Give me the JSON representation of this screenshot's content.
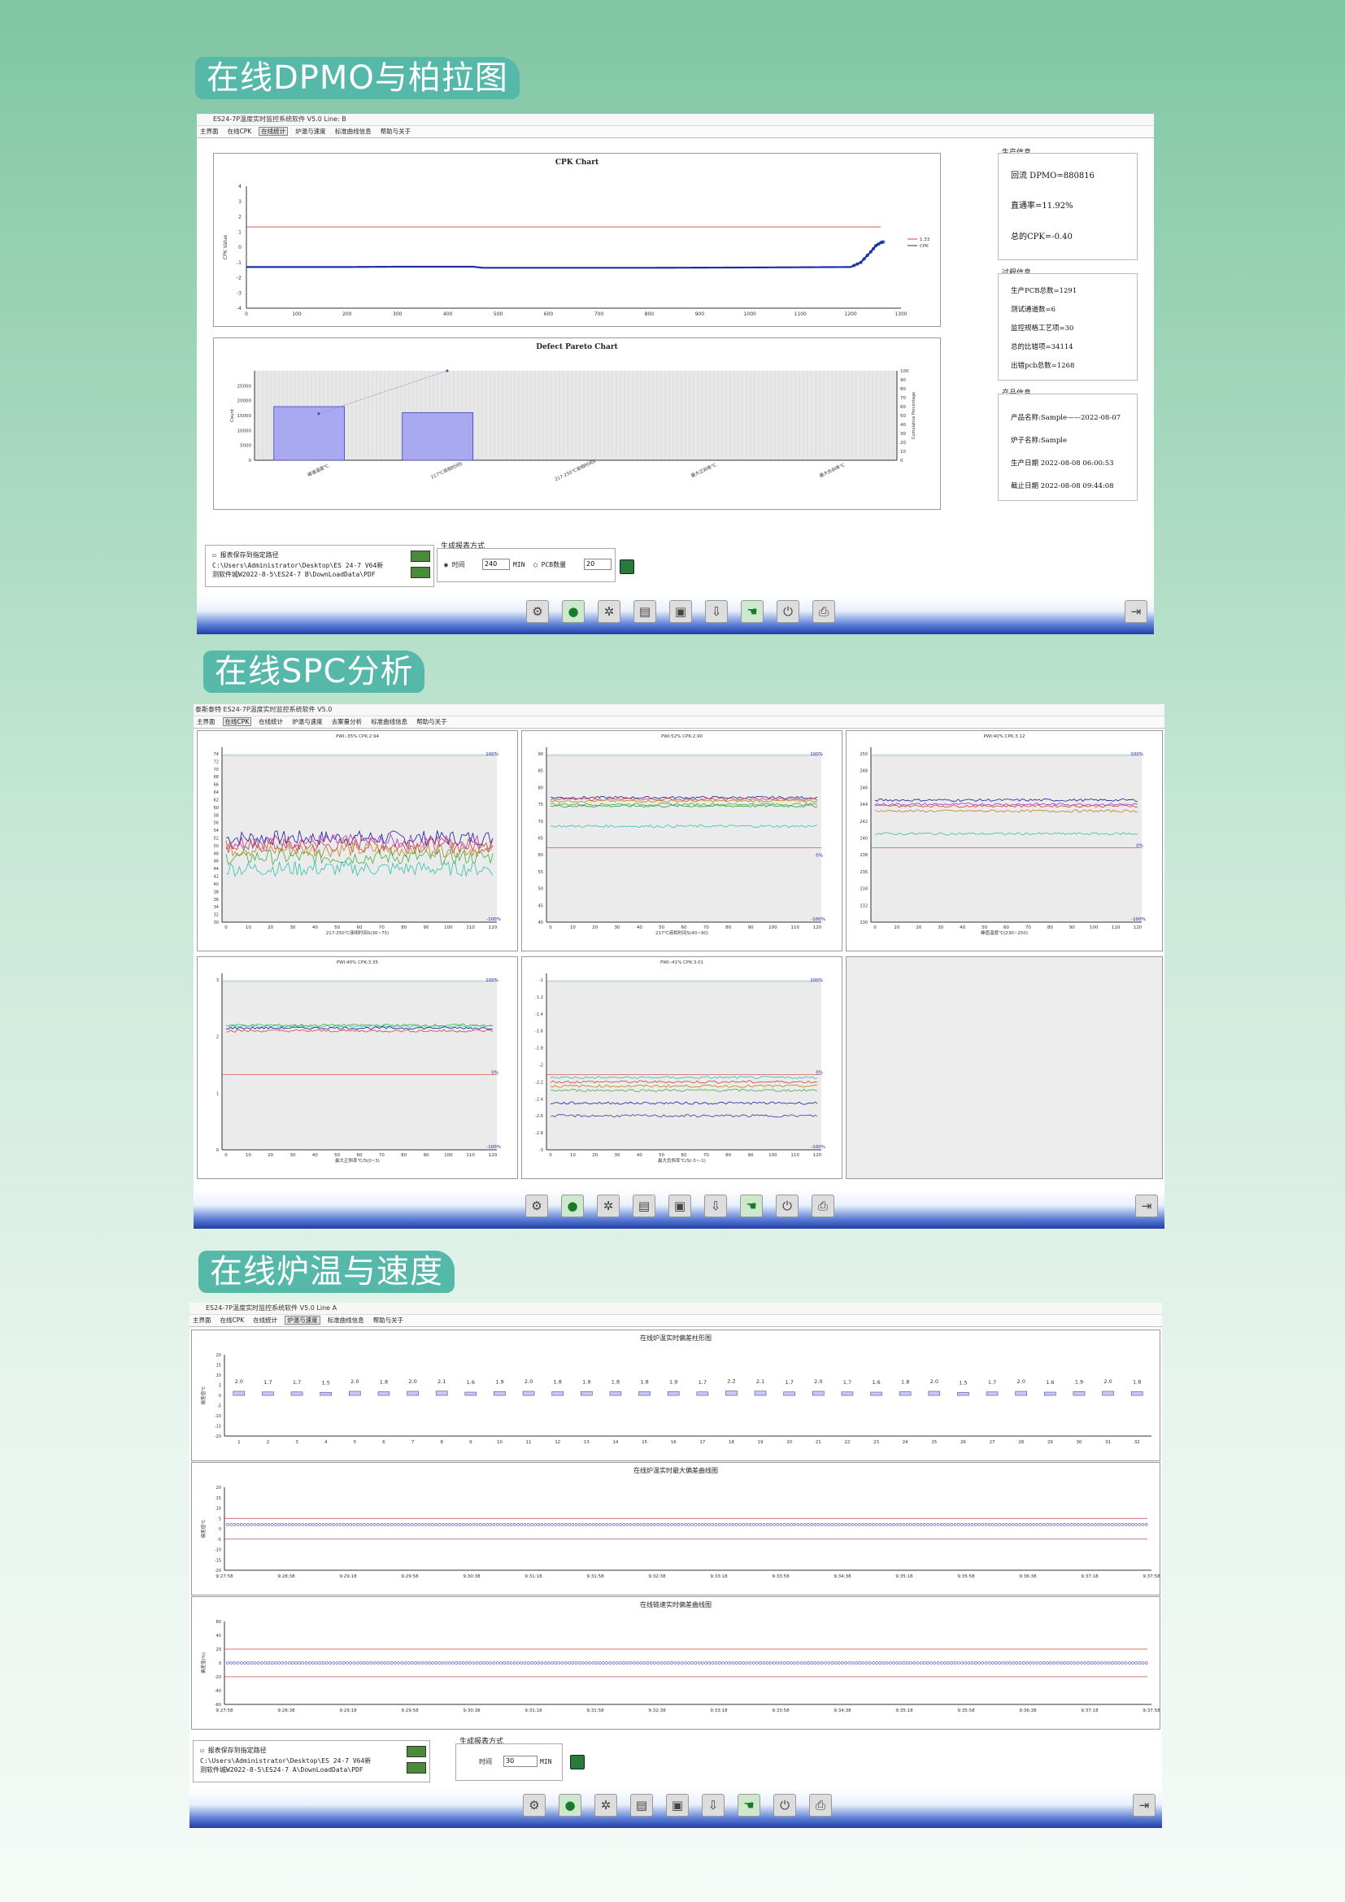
{
  "sections": {
    "s1": "在线DPMO与柏拉图",
    "s2": "在线SPC分析",
    "s3": "在线炉温与速度"
  },
  "panel1": {
    "titlebar": "ES24-7P温度实时监控系统软件 V5.0        Line: B",
    "menu": [
      "主界面",
      "在线CPK",
      "在线统计",
      "炉温与速度",
      "标准曲线信息",
      "帮助与关于"
    ],
    "active_menu": "在线统计",
    "cpk_chart_title": "CPK Chart",
    "pareto_title": "Defect Pareto Chart",
    "prod_info": {
      "group_label": "生产信息",
      "dpmo": "回流 DPMO=880816",
      "pass_rate": "直通率=11.92%",
      "cpk": "总的CPK=-0.40"
    },
    "process_info": {
      "group_label": "过程信息",
      "lines": [
        "生产PCB总数=1291",
        "测试通道数=6",
        "监控规格工艺项=30",
        "总的比错项=34114",
        "出错pcb总数=1268"
      ]
    },
    "product_info": {
      "group_label": "产品信息",
      "lines": [
        "产品名称:Sample——2022-08-07",
        "炉子名称:Sample",
        "生产日期  2022-08-08 06:00:53",
        "截止日期  2022-08-08 09:44:08"
      ]
    },
    "save": {
      "checkbox": "报表保存到指定路径",
      "path1": "C:\\Users\\Administrator\\Desktop\\ES 24-7 V64新",
      "path2": "测软件城W2022-8-5\\ES24-7  B\\DownLoadData\\PDF"
    },
    "report": {
      "group_label": "生成报表方式",
      "time_label": "时间",
      "time_value": "240",
      "unit": "MIN",
      "pcb_label": "PCB数量",
      "pcb_value": "20"
    }
  },
  "panel2": {
    "titlebar": "泰斯泰特 ES24-7P温度实时监控系统软件 V5.0",
    "menu": [
      "主界面",
      "在线CPK",
      "在线统计",
      "炉温与速度",
      "去案量分析",
      "标准曲线信息",
      "帮助与关于"
    ],
    "active_menu": "在线CPK"
  },
  "panel3": {
    "titlebar": "ES24-7P温度实时监控系统软件 V5.0        Line A",
    "menu": [
      "主界面",
      "在线CPK",
      "在线统计",
      "炉温与速度",
      "标准曲线信息",
      "帮助与关于"
    ],
    "active_menu": "炉温与速度",
    "save": {
      "checkbox": "报表保存到指定路径",
      "path1": "C:\\Users\\Administrator\\Desktop\\ES 24-7 V64新",
      "path2": "测软件城W2022-8-5\\ES24-7  A\\DownLoadData\\PDF"
    },
    "report": {
      "group_label": "生成报表方式",
      "time_label": "时间",
      "time_value": "30",
      "unit": "MIN"
    }
  },
  "toolbar_icons": [
    "settings-icon",
    "record-icon",
    "gear-icon",
    "chart-icon",
    "camera-icon",
    "download-icon",
    "hand-icon",
    "plug-icon",
    "print-icon"
  ],
  "exit_icon": "exit-icon",
  "chart_data": [
    {
      "id": "cpk",
      "type": "line",
      "title": "CPK Chart",
      "ylabel": "CPK Value",
      "xlim": [
        0,
        1300
      ],
      "ylim": [
        -4,
        4
      ],
      "xticks": [
        0,
        100,
        200,
        300,
        400,
        500,
        600,
        700,
        800,
        900,
        1000,
        1100,
        1200,
        1300
      ],
      "yticks": [
        -4,
        -3,
        -2,
        -1,
        0,
        1,
        2,
        3,
        4
      ],
      "limit": 1.33,
      "series": [
        {
          "name": "1.33",
          "color": "#d04040",
          "x": [
            0,
            1300
          ],
          "y": [
            1.33,
            1.33
          ]
        },
        {
          "name": "CPK",
          "color": "#1a2fa8",
          "x": [
            0,
            100,
            200,
            300,
            450,
            470,
            600,
            800,
            1000,
            1200,
            1220,
            1240,
            1250,
            1260,
            1265
          ],
          "y": [
            -1.3,
            -1.3,
            -1.3,
            -1.28,
            -1.28,
            -1.35,
            -1.35,
            -1.35,
            -1.33,
            -1.3,
            -1.0,
            -0.3,
            0.1,
            0.3,
            0.35
          ]
        }
      ]
    },
    {
      "id": "pareto",
      "type": "bar",
      "title": "Defect Pareto Chart",
      "ylabel": "Count",
      "y2label": "Cumulative Percentage",
      "categories": [
        "峰值温度℃",
        "217℃液相时间S",
        "217-250℃液相时间S",
        "最大正斜率℃",
        "最大负斜率℃"
      ],
      "values": [
        18000,
        16000,
        0,
        0,
        0
      ],
      "cumulative": [
        52,
        100,
        100,
        100,
        100
      ],
      "ylim": [
        0,
        30000
      ],
      "yticks": [
        0,
        5000,
        10000,
        15000,
        20000,
        25000
      ],
      "y2ticks": [
        0,
        10,
        20,
        30,
        40,
        50,
        60,
        70,
        80,
        90,
        100
      ]
    },
    {
      "id": "spc1",
      "type": "line",
      "header": "PWI:-35%        CPK:2.94",
      "xlabel": "217-250℃液相时间S(30~75)",
      "ylim": [
        30,
        74
      ],
      "yticks": [
        30,
        32,
        34,
        36,
        38,
        40,
        42,
        44,
        46,
        48,
        50,
        52,
        54,
        56,
        58,
        60,
        62,
        64,
        66,
        68,
        70,
        72,
        74
      ],
      "xticks": [
        0,
        10,
        20,
        30,
        40,
        50,
        60,
        70,
        80,
        90,
        100,
        110,
        120
      ],
      "labels": {
        "top": "100%",
        "bottom": "-100%"
      },
      "series_levels": [
        52,
        51,
        50,
        49,
        47,
        44
      ],
      "colors": [
        "#1a1aa0",
        "#b030b0",
        "#d04040",
        "#c08020",
        "#40b040",
        "#30c0b0"
      ]
    },
    {
      "id": "spc2",
      "type": "line",
      "header": "PWI:52%        CPK:2.90",
      "xlabel": "217℃液相时间S(40~90)",
      "ylim": [
        40,
        90
      ],
      "yticks": [
        40,
        45,
        50,
        55,
        60,
        65,
        70,
        75,
        80,
        85,
        90
      ],
      "xticks": [
        0,
        10,
        20,
        30,
        40,
        50,
        60,
        70,
        80,
        90,
        100,
        110,
        120
      ],
      "labels": {
        "top": "100%",
        "right": "0%",
        "bottom": "-100%"
      },
      "series_levels": [
        77,
        76.5,
        76,
        75,
        74.5,
        68.5
      ],
      "colors": [
        "#1a1aa0",
        "#d04040",
        "#c08020",
        "#40b040",
        "#30a030",
        "#30c0c0"
      ]
    },
    {
      "id": "spc3",
      "type": "line",
      "header": "PWI:40%        CPK:3.12",
      "xlabel": "峰值温度℃(230~250)",
      "ylim": [
        230,
        250
      ],
      "yticks": [
        230,
        232,
        234,
        236,
        238,
        240,
        242,
        244,
        246,
        248,
        250
      ],
      "xticks": [
        0,
        10,
        20,
        30,
        40,
        50,
        60,
        70,
        80,
        90,
        100,
        110,
        120
      ],
      "labels": {
        "top": "100%",
        "right": "0%",
        "bottom": "-100%"
      },
      "series_levels": [
        244.5,
        244,
        243.8,
        243.2,
        240.5
      ],
      "colors": [
        "#1a1aa0",
        "#b030b0",
        "#d04040",
        "#c08020",
        "#30c0b0"
      ]
    },
    {
      "id": "spc4",
      "type": "line",
      "header": "PWI:40%        CPK:3.35",
      "xlabel": "最大正斜率℃/S(0~3)",
      "ylim": [
        0,
        3
      ],
      "yticks": [
        0,
        1,
        2,
        3
      ],
      "xticks": [
        0,
        10,
        20,
        30,
        40,
        50,
        60,
        70,
        80,
        90,
        100,
        110,
        120
      ],
      "labels": {
        "top": "100%",
        "right": "0%",
        "bottom": "-100%"
      },
      "series_levels": [
        2.2,
        2.18,
        2.15,
        2.1
      ],
      "colors": [
        "#40b040",
        "#30c0b0",
        "#1a1aa0",
        "#d04040"
      ]
    },
    {
      "id": "spc5",
      "type": "line",
      "header": "PWI:-41%        CPK:3.01",
      "xlabel": "最大负斜率℃/S(-3~-1)",
      "ylim": [
        -3,
        -1
      ],
      "yticks": [
        -3,
        -2.8,
        -2.6,
        -2.4,
        -2.2,
        -2,
        -1.8,
        -1.6,
        -1.4,
        -1.2,
        -1
      ],
      "xticks": [
        0,
        10,
        20,
        30,
        40,
        50,
        60,
        70,
        80,
        90,
        100,
        110,
        120
      ],
      "labels": {
        "top": "100%",
        "right": "0%",
        "bottom": "-100%"
      },
      "series_levels": [
        -2.15,
        -2.2,
        -2.25,
        -2.3,
        -2.45,
        -2.6
      ],
      "colors": [
        "#30c0b0",
        "#d04040",
        "#c08020",
        "#40b040",
        "#1a1aa0",
        "#3a3a9a"
      ]
    },
    {
      "id": "temp-bar",
      "type": "bar",
      "title": "在线炉温实时偏差柱形图",
      "ylabel": "偏差值℃",
      "ylim": [
        -20,
        20
      ],
      "yticks": [
        -20,
        -15,
        -10,
        -5,
        0,
        5,
        10,
        15,
        20
      ],
      "categories": [
        "1",
        "2",
        "3",
        "4",
        "5",
        "6",
        "7",
        "8",
        "9",
        "10",
        "11",
        "12",
        "13",
        "14",
        "15",
        "16",
        "17",
        "18",
        "19",
        "20",
        "21",
        "22",
        "23",
        "24",
        "25",
        "26",
        "27",
        "28",
        "29",
        "30",
        "31",
        "32"
      ],
      "values": [
        2.0,
        1.7,
        1.7,
        1.5,
        2.0,
        1.8,
        2.0,
        2.1,
        1.6,
        1.9,
        2.0,
        1.8,
        1.9,
        1.8,
        1.8,
        1.9,
        1.7,
        2.2,
        2.1,
        1.7,
        2.0,
        1.7,
        1.6,
        1.8,
        2.0,
        1.5,
        1.7,
        2.0,
        1.6,
        1.9,
        2.0,
        1.8
      ],
      "value_labels": [
        "2.0",
        "1.7",
        "1.7",
        "1.5",
        "2.0",
        "1.8",
        "2.0",
        "2.1",
        "1.6",
        "1.9",
        "2.0",
        "1.8",
        "1.9",
        "1.8",
        "1.8",
        "1.9",
        "1.7",
        "2.2",
        "2.1",
        "1.7",
        "2.0",
        "1.7",
        "1.6",
        "1.8",
        "2.0",
        "1.5",
        "1.7",
        "2.0",
        "1.6",
        "1.9",
        "2.0",
        "1.8"
      ]
    },
    {
      "id": "temp-line",
      "type": "line",
      "title": "在线炉温实时最大偏差曲线图",
      "ylabel": "偏差值℃",
      "ylim": [
        -20,
        20
      ],
      "yticks": [
        -20,
        -15,
        -10,
        -5,
        0,
        5,
        10,
        15,
        20
      ],
      "x": [
        "9:27:58",
        "9:28:38",
        "9:29:18",
        "9:29:58",
        "9:30:38",
        "9:31:18",
        "9:31:58",
        "9:32:38",
        "9:33:18",
        "9:33:58",
        "9:34:38",
        "9:35:18",
        "9:35:58",
        "9:36:38",
        "9:37:18",
        "9:37:58"
      ],
      "limits": [
        5,
        -5
      ],
      "series_level": 2
    },
    {
      "id": "speed-line",
      "type": "line",
      "title": "在线链速实时偏差曲线图",
      "ylabel": "偏差值(%)",
      "ylim": [
        -60,
        60
      ],
      "yticks": [
        -60,
        -40,
        -20,
        0,
        20,
        40,
        60
      ],
      "x": [
        "9:27:58",
        "9:28:38",
        "9:29:18",
        "9:29:58",
        "9:30:38",
        "9:31:18",
        "9:31:58",
        "9:32:38",
        "9:33:18",
        "9:33:58",
        "9:34:38",
        "9:35:18",
        "9:35:58",
        "9:36:38",
        "9:37:18",
        "9:37:58"
      ],
      "limits": [
        20,
        -20
      ],
      "series_level": 0
    }
  ]
}
